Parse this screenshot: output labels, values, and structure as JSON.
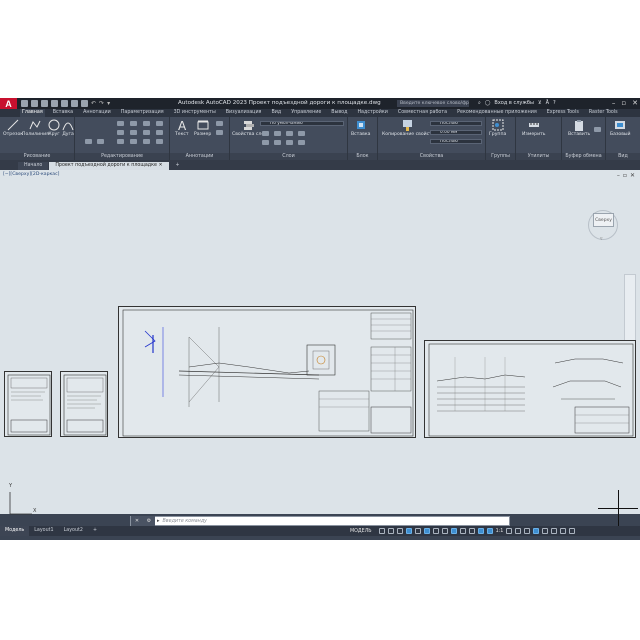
{
  "app": {
    "title": "Autodesk AutoCAD 2023    Проект подъездной дороги к площадке.dwg",
    "search_placeholder": "Введите ключевое слово/фразу",
    "user": "Вход в службы",
    "logo": "A"
  },
  "ribbon_tabs": [
    "Главная",
    "Вставка",
    "Аннотации",
    "Параметризация",
    "3D инструменты",
    "Визуализация",
    "Вид",
    "Управление",
    "Вывод",
    "Надстройки",
    "Совместная работа",
    "Рекомендованные приложения",
    "Express Tools",
    "Raster Tools"
  ],
  "ribbon": {
    "draw": {
      "label": "Рисование",
      "tools": [
        "Отрезок",
        "Полилиния",
        "Круг",
        "Дуга"
      ]
    },
    "modify": {
      "label": "Редактирование"
    },
    "annotation": {
      "label": "Аннотации",
      "tools": [
        "Текст",
        "Размер"
      ]
    },
    "layers": {
      "label": "Слои",
      "tool": "Свойства слоя",
      "current_layer": "По умолчанию"
    },
    "block": {
      "label": "Блок",
      "tool": "Вставка"
    },
    "properties": {
      "label": "Свойства",
      "tool": "Копирование свойств",
      "color": "ПоСлою",
      "lineweight": "0.00 мм",
      "linetype": "ПоСлою"
    },
    "groups": {
      "label": "Группы",
      "tool": "Группа"
    },
    "utilities": {
      "label": "Утилиты",
      "tool": "Измерить"
    },
    "clipboard": {
      "label": "Буфер обмена",
      "tool": "Вставить"
    },
    "view": {
      "label": "Вид",
      "tool": "Базовый"
    }
  },
  "doc_tabs": [
    "Начало",
    "Проект подъездной дороги к площадке"
  ],
  "viewport": {
    "label": "[−][Сверху][2D-каркас]",
    "navcube": "Сверху"
  },
  "command": {
    "placeholder": "Введите команду"
  },
  "status": {
    "layouts": [
      "Модель",
      "Layout1",
      "Layout2"
    ],
    "mode": "МОДЕЛЬ",
    "zoom": "1:1"
  },
  "ucs": {
    "x": "X",
    "y": "Y"
  },
  "colors": {
    "accent": "#c8102e",
    "canvas": "#dce3e8",
    "ribbon": "#434c5c"
  }
}
